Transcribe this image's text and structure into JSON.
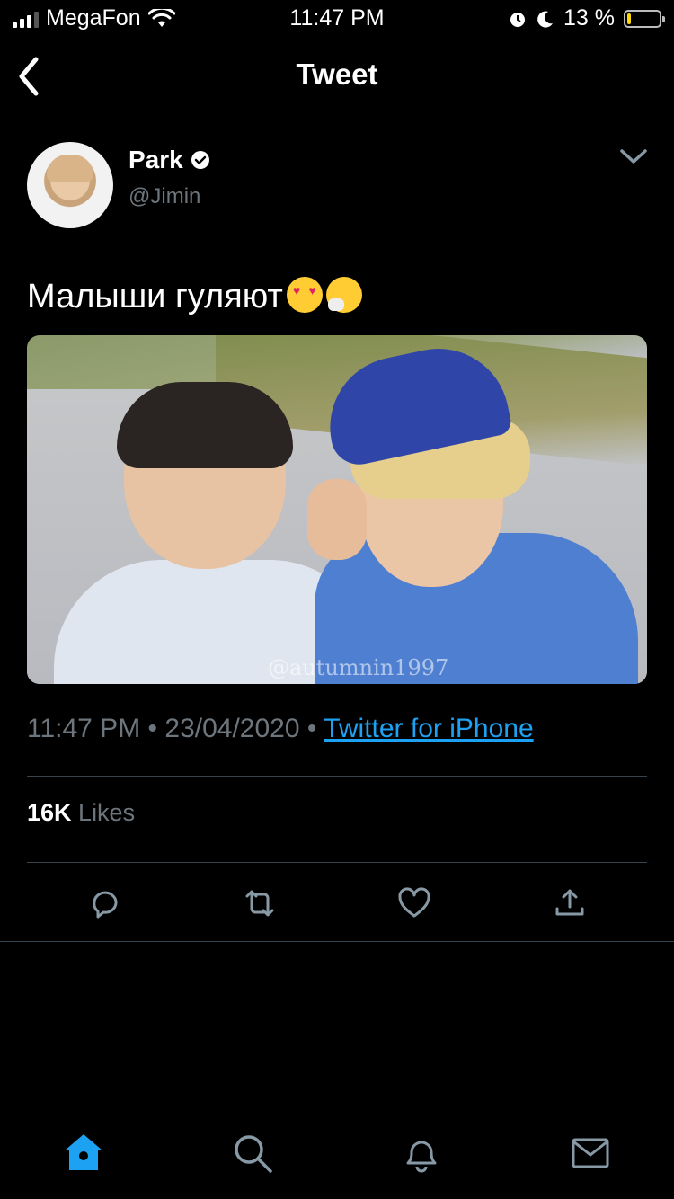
{
  "status_bar": {
    "carrier": "MegaFon",
    "time": "11:47 PM",
    "battery_percent": "13 %",
    "battery_level": 0.13,
    "battery_color": "#ffd60a"
  },
  "nav": {
    "title": "Tweet",
    "back_icon": "chevron-left-icon"
  },
  "tweet": {
    "author_name": "Park",
    "author_handle": "@Jimin",
    "verified": true,
    "text": "Малыши гуляют",
    "emojis": [
      "heart-eyes-emoji",
      "sneezing-face-emoji"
    ],
    "media_watermark": "@autumnin1997",
    "time": "11:47 PM",
    "date": "23/04/2020",
    "separator": "•",
    "source": "Twitter for iPhone",
    "likes_count": "16K",
    "likes_label": "Likes"
  },
  "actions": [
    "reply-icon",
    "retweet-icon",
    "like-icon",
    "share-icon"
  ],
  "tab_bar": [
    "home-icon",
    "search-icon",
    "notifications-icon",
    "messages-icon"
  ],
  "colors": {
    "background": "#000000",
    "accent": "#1da1f2",
    "secondary_text": "#6e767d",
    "divider": "#38444d"
  }
}
